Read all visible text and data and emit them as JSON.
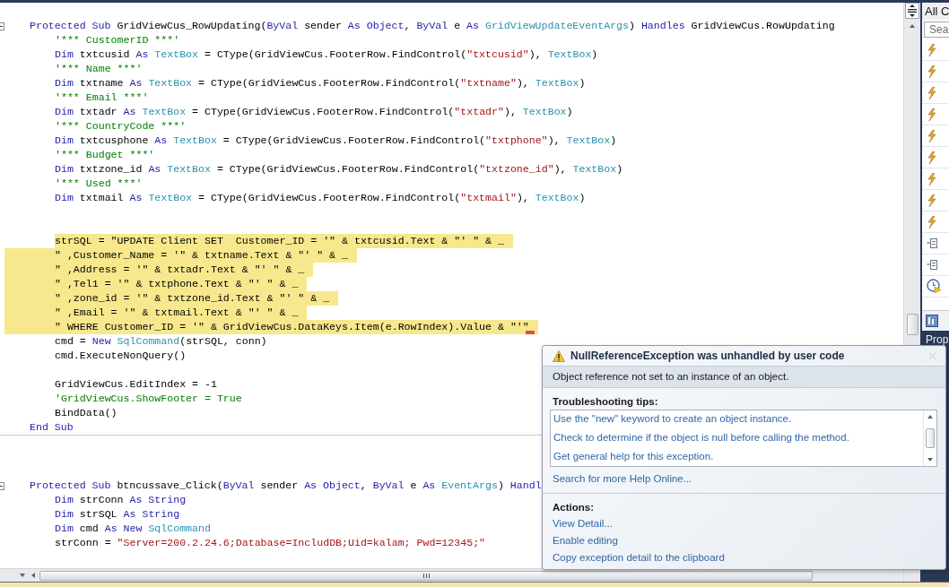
{
  "editor": {
    "lines": [
      {
        "kind": "line",
        "highlighted": false,
        "expanded": true,
        "tokens": [
          {
            "kind": "kw",
            "text": "Protected Sub"
          },
          {
            "kind": "txt",
            "text": " GridViewCus_RowUpdating("
          },
          {
            "kind": "kw",
            "text": "ByVal"
          },
          {
            "kind": "txt",
            "text": " sender "
          },
          {
            "kind": "kw",
            "text": "As Object"
          },
          {
            "kind": "txt",
            "text": ", "
          },
          {
            "kind": "kw",
            "text": "ByVal"
          },
          {
            "kind": "txt",
            "text": " e "
          },
          {
            "kind": "kw",
            "text": "As "
          },
          {
            "kind": "type",
            "text": "GridViewUpdateEventArgs"
          },
          {
            "kind": "txt",
            "text": ") "
          },
          {
            "kind": "kw",
            "text": "Handles"
          },
          {
            "kind": "txt",
            "text": " GridViewCus.RowUpdating"
          }
        ],
        "children": [
          {
            "kind": "line",
            "highlighted": false,
            "tokens": [
              {
                "kind": "cmt",
                "text": "'*** CustomerID ***'"
              }
            ]
          },
          {
            "kind": "line",
            "highlighted": false,
            "tokens": [
              {
                "kind": "kw",
                "text": "Dim"
              },
              {
                "kind": "txt",
                "text": " txtcusid "
              },
              {
                "kind": "kw",
                "text": "As "
              },
              {
                "kind": "type",
                "text": "TextBox"
              },
              {
                "kind": "txt",
                "text": " = CType(GridViewCus.FooterRow.FindControl("
              },
              {
                "kind": "str",
                "text": "\"txtcusid\""
              },
              {
                "kind": "txt",
                "text": "), "
              },
              {
                "kind": "type",
                "text": "TextBox"
              },
              {
                "kind": "txt",
                "text": ")"
              }
            ]
          },
          {
            "kind": "line",
            "highlighted": false,
            "tokens": [
              {
                "kind": "cmt",
                "text": "'*** Name ***'"
              }
            ]
          },
          {
            "kind": "line",
            "highlighted": false,
            "tokens": [
              {
                "kind": "kw",
                "text": "Dim"
              },
              {
                "kind": "txt",
                "text": " txtname "
              },
              {
                "kind": "kw",
                "text": "As "
              },
              {
                "kind": "type",
                "text": "TextBox"
              },
              {
                "kind": "txt",
                "text": " = CType(GridViewCus.FooterRow.FindControl("
              },
              {
                "kind": "str",
                "text": "\"txtname\""
              },
              {
                "kind": "txt",
                "text": "), "
              },
              {
                "kind": "type",
                "text": "TextBox"
              },
              {
                "kind": "txt",
                "text": ")"
              }
            ]
          },
          {
            "kind": "line",
            "highlighted": false,
            "tokens": [
              {
                "kind": "cmt",
                "text": "'*** Email ***'"
              }
            ]
          },
          {
            "kind": "line",
            "highlighted": false,
            "tokens": [
              {
                "kind": "kw",
                "text": "Dim"
              },
              {
                "kind": "txt",
                "text": " txtadr "
              },
              {
                "kind": "kw",
                "text": "As "
              },
              {
                "kind": "type",
                "text": "TextBox"
              },
              {
                "kind": "txt",
                "text": " = CType(GridViewCus.FooterRow.FindControl("
              },
              {
                "kind": "str",
                "text": "\"txtadr\""
              },
              {
                "kind": "txt",
                "text": "), "
              },
              {
                "kind": "type",
                "text": "TextBox"
              },
              {
                "kind": "txt",
                "text": ")"
              }
            ]
          },
          {
            "kind": "line",
            "highlighted": false,
            "tokens": [
              {
                "kind": "cmt",
                "text": "'*** CountryCode ***'"
              }
            ]
          },
          {
            "kind": "line",
            "highlighted": false,
            "tokens": [
              {
                "kind": "kw",
                "text": "Dim"
              },
              {
                "kind": "txt",
                "text": " txtcusphone "
              },
              {
                "kind": "kw",
                "text": "As "
              },
              {
                "kind": "type",
                "text": "TextBox"
              },
              {
                "kind": "txt",
                "text": " = CType(GridViewCus.FooterRow.FindControl("
              },
              {
                "kind": "str",
                "text": "\"txtphone\""
              },
              {
                "kind": "txt",
                "text": "), "
              },
              {
                "kind": "type",
                "text": "TextBox"
              },
              {
                "kind": "txt",
                "text": ")"
              }
            ]
          },
          {
            "kind": "line",
            "highlighted": false,
            "tokens": [
              {
                "kind": "cmt",
                "text": "'*** Budget ***'"
              }
            ]
          },
          {
            "kind": "line",
            "highlighted": false,
            "tokens": [
              {
                "kind": "kw",
                "text": "Dim"
              },
              {
                "kind": "txt",
                "text": " txtzone_id "
              },
              {
                "kind": "kw",
                "text": "As "
              },
              {
                "kind": "type",
                "text": "TextBox"
              },
              {
                "kind": "txt",
                "text": " = CType(GridViewCus.FooterRow.FindControl("
              },
              {
                "kind": "str",
                "text": "\"txtzone_id\""
              },
              {
                "kind": "txt",
                "text": "), "
              },
              {
                "kind": "type",
                "text": "TextBox"
              },
              {
                "kind": "txt",
                "text": ")"
              }
            ]
          },
          {
            "kind": "line",
            "highlighted": false,
            "tokens": [
              {
                "kind": "cmt",
                "text": "'*** Used ***'"
              }
            ]
          },
          {
            "kind": "line",
            "highlighted": false,
            "tokens": [
              {
                "kind": "kw",
                "text": "Dim"
              },
              {
                "kind": "txt",
                "text": " txtmail "
              },
              {
                "kind": "kw",
                "text": "As "
              },
              {
                "kind": "type",
                "text": "TextBox"
              },
              {
                "kind": "txt",
                "text": " = CType(GridViewCus.FooterRow.FindControl("
              },
              {
                "kind": "str",
                "text": "\"txtmail\""
              },
              {
                "kind": "txt",
                "text": "), "
              },
              {
                "kind": "type",
                "text": "TextBox"
              },
              {
                "kind": "txt",
                "text": ")"
              }
            ]
          },
          {
            "kind": "blank"
          },
          {
            "kind": "blank"
          },
          {
            "kind": "line",
            "highlighted": true,
            "tokens": [
              {
                "kind": "txt",
                "text": "strSQL = \"UPDATE Client SET  Customer_ID = '\" & txtcusid.Text & \"' \" & _"
              }
            ]
          },
          {
            "kind": "line",
            "highlighted": true,
            "tokens": [
              {
                "kind": "txt",
                "text": "\" ,Customer_Name = '\" & txtname.Text & \"' \" & _"
              }
            ]
          },
          {
            "kind": "line",
            "highlighted": true,
            "tokens": [
              {
                "kind": "txt",
                "text": "\" ,Address = '\" & txtadr.Text & \"' \" & _"
              }
            ]
          },
          {
            "kind": "line",
            "highlighted": true,
            "tokens": [
              {
                "kind": "txt",
                "text": "\" ,Tel1 = '\" & txtphone.Text & \"' \" & _"
              }
            ]
          },
          {
            "kind": "line",
            "highlighted": true,
            "tokens": [
              {
                "kind": "txt",
                "text": "\" ,zone_id = '\" & txtzone_id.Text & \"' \" & _"
              }
            ]
          },
          {
            "kind": "line",
            "highlighted": true,
            "tokens": [
              {
                "kind": "txt",
                "text": "\" ,Email = '\" & txtmail.Text & \"' \" & _"
              }
            ]
          },
          {
            "kind": "line",
            "highlighted": true,
            "error": true,
            "tokens": [
              {
                "kind": "txt",
                "text": "\" WHERE Customer_ID = '\" & GridViewCus.DataKeys.Item(e.RowIndex).Value & \"'\""
              }
            ]
          },
          {
            "kind": "line",
            "highlighted": false,
            "tokens": [
              {
                "kind": "txt",
                "text": "cmd = "
              },
              {
                "kind": "kw",
                "text": "New "
              },
              {
                "kind": "type",
                "text": "SqlCommand"
              },
              {
                "kind": "txt",
                "text": "(strSQL, conn)"
              }
            ]
          },
          {
            "kind": "line",
            "highlighted": false,
            "tokens": [
              {
                "kind": "txt",
                "text": "cmd.ExecuteNonQuery()"
              }
            ]
          },
          {
            "kind": "blank"
          },
          {
            "kind": "line",
            "highlighted": false,
            "tokens": [
              {
                "kind": "txt",
                "text": "GridViewCus.EditIndex = -1"
              }
            ]
          },
          {
            "kind": "line",
            "highlighted": false,
            "tokens": [
              {
                "kind": "cmt",
                "text": "'GridViewCus.ShowFooter = True"
              }
            ]
          },
          {
            "kind": "line",
            "highlighted": false,
            "tokens": [
              {
                "kind": "txt",
                "text": "BindData()"
              }
            ]
          }
        ]
      },
      {
        "kind": "line",
        "highlighted": false,
        "tokens": [
          {
            "kind": "kw",
            "text": "End Sub"
          }
        ]
      },
      {
        "kind": "separator"
      },
      {
        "kind": "blank"
      },
      {
        "kind": "blank"
      },
      {
        "kind": "blank"
      },
      {
        "kind": "line",
        "highlighted": false,
        "expanded": true,
        "tokens": [
          {
            "kind": "kw",
            "text": "Protected Sub"
          },
          {
            "kind": "txt",
            "text": " btncussave_Click("
          },
          {
            "kind": "kw",
            "text": "ByVal"
          },
          {
            "kind": "txt",
            "text": " sender "
          },
          {
            "kind": "kw",
            "text": "As Object"
          },
          {
            "kind": "txt",
            "text": ", "
          },
          {
            "kind": "kw",
            "text": "ByVal"
          },
          {
            "kind": "txt",
            "text": " e "
          },
          {
            "kind": "kw",
            "text": "As "
          },
          {
            "kind": "type",
            "text": "EventArgs"
          },
          {
            "kind": "txt",
            "text": ") "
          },
          {
            "kind": "kw",
            "text": "Handl"
          }
        ],
        "children": [
          {
            "kind": "line",
            "highlighted": false,
            "tokens": [
              {
                "kind": "kw",
                "text": "Dim"
              },
              {
                "kind": "txt",
                "text": " strConn "
              },
              {
                "kind": "kw",
                "text": "As String"
              }
            ]
          },
          {
            "kind": "line",
            "highlighted": false,
            "tokens": [
              {
                "kind": "kw",
                "text": "Dim"
              },
              {
                "kind": "txt",
                "text": " strSQL "
              },
              {
                "kind": "kw",
                "text": "As String"
              }
            ]
          },
          {
            "kind": "line",
            "highlighted": false,
            "tokens": [
              {
                "kind": "kw",
                "text": "Dim"
              },
              {
                "kind": "txt",
                "text": " cmd "
              },
              {
                "kind": "kw",
                "text": "As New "
              },
              {
                "kind": "type",
                "text": "SqlCommand"
              }
            ]
          },
          {
            "kind": "line",
            "highlighted": false,
            "tokens": [
              {
                "kind": "txt",
                "text": "strConn = "
              },
              {
                "kind": "str",
                "text": "\"Server=200.2.24.6;Database=IncludDB;Uid=kalam; Pwd=12345;\""
              }
            ]
          }
        ]
      }
    ]
  },
  "side_panel": {
    "dropdown": "All C",
    "search": {
      "placeholder": "Sea"
    },
    "items": [
      {
        "kind": "event"
      },
      {
        "kind": "event"
      },
      {
        "kind": "event"
      },
      {
        "kind": "event"
      },
      {
        "kind": "event"
      },
      {
        "kind": "event"
      },
      {
        "kind": "event"
      },
      {
        "kind": "event"
      },
      {
        "kind": "event"
      },
      {
        "kind": "property"
      },
      {
        "kind": "property"
      },
      {
        "kind": "clock"
      }
    ],
    "tab": "Prop"
  },
  "exception": {
    "title": "NullReferenceException was unhandled by user code",
    "message": "Object reference not set to an instance of an object.",
    "tips_heading": "Troubleshooting tips:",
    "tips": [
      "Use the \"new\" keyword to create an object instance.",
      "Check to determine if the object is null before calling the method.",
      "Get general help for this exception."
    ],
    "search_link": "Search for more Help Online...",
    "actions_heading": "Actions:",
    "actions": [
      "View Detail...",
      "Enable editing",
      "Copy exception detail to the clipboard"
    ]
  }
}
